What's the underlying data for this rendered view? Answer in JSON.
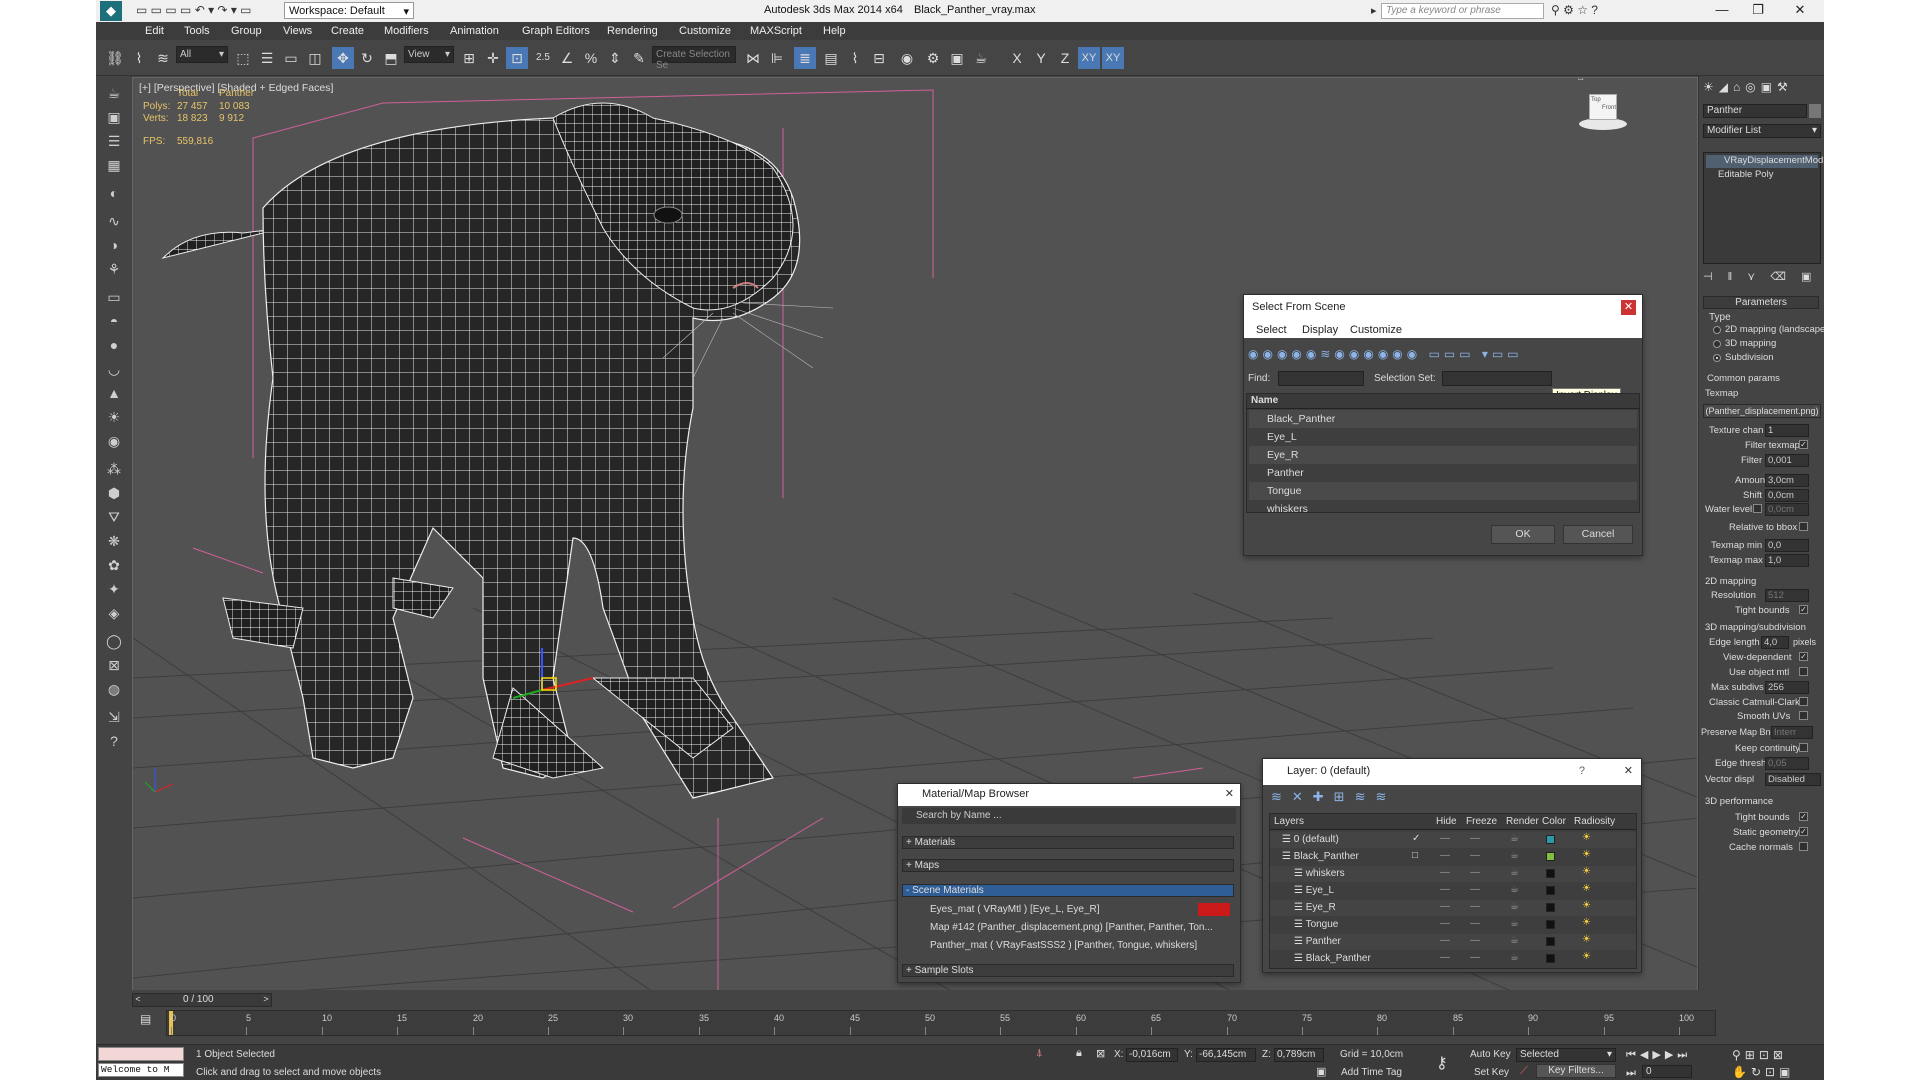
{
  "window": {
    "title": "Autodesk 3ds Max  2014 x64",
    "filename": "Black_Panther_vray.max",
    "workspace": "Workspace: Default",
    "search_placeholder": "Type a keyword or phrase"
  },
  "menu": [
    "Edit",
    "Tools",
    "Group",
    "Views",
    "Create",
    "Modifiers",
    "Animation",
    "Graph Editors",
    "Rendering",
    "Customize",
    "MAXScript",
    "Help"
  ],
  "toolbar": {
    "filter": "All",
    "ref_coord": "View",
    "snap_value": "2.5",
    "selection_set": "Create Selection Se",
    "axes": [
      "X",
      "Y",
      "Z",
      "XY",
      "XY"
    ]
  },
  "viewport": {
    "label": "[+] [Perspective] [Shaded + Edged Faces]",
    "stats": {
      "col_total": "Total",
      "col_obj": "Panther",
      "polys_label": "Polys:",
      "polys_total": "27 457",
      "polys_obj": "10 083",
      "verts_label": "Verts:",
      "verts_total": "18 823",
      "verts_obj": "9 912",
      "fps_label": "FPS:",
      "fps": "559,816"
    },
    "viewcube_labels": [
      "Top",
      "Front"
    ]
  },
  "select_dialog": {
    "title": "Select From Scene",
    "menus": [
      "Select",
      "Display",
      "Customize"
    ],
    "find_label": "Find:",
    "selset_label": "Selection Set:",
    "tooltip": "Invert Display",
    "col_name": "Name",
    "items": [
      "Black_Panther",
      "Eye_L",
      "Eye_R",
      "Panther",
      "Tongue",
      "whiskers"
    ],
    "ok": "OK",
    "cancel": "Cancel"
  },
  "material_browser": {
    "title": "Material/Map Browser",
    "search": "Search by Name ...",
    "groups": [
      "+ Materials",
      "+ Maps",
      "- Scene Materials",
      "+ Sample Slots"
    ],
    "items": [
      "Eyes_mat  ( VRayMtl )  [Eye_L, Eye_R]",
      "Map #142 (Panther_displacement.png)  [Panther, Panther, Ton...",
      "Panther_mat  ( VRayFastSSS2 )  [Panther, Tongue, whiskers]"
    ],
    "swatch_color": "#cc1a1a"
  },
  "layer_dialog": {
    "title": "Layer: 0 (default)",
    "help": "?",
    "cols": [
      "Layers",
      "Hide",
      "Freeze",
      "Render",
      "Color",
      "Radiosity"
    ],
    "rows": [
      {
        "name": "0 (default)",
        "indent": 0,
        "color": "#2a9aa8",
        "check": "✓"
      },
      {
        "name": "Black_Panther",
        "indent": 0,
        "color": "#7fbf3f",
        "check": "□"
      },
      {
        "name": "whiskers",
        "indent": 1,
        "color": "#111111",
        "check": ""
      },
      {
        "name": "Eye_L",
        "indent": 1,
        "color": "#111111",
        "check": ""
      },
      {
        "name": "Eye_R",
        "indent": 1,
        "color": "#111111",
        "check": ""
      },
      {
        "name": "Tongue",
        "indent": 1,
        "color": "#111111",
        "check": ""
      },
      {
        "name": "Panther",
        "indent": 1,
        "color": "#111111",
        "check": ""
      },
      {
        "name": "Black_Panther",
        "indent": 1,
        "color": "#111111",
        "check": ""
      }
    ]
  },
  "command_panel": {
    "object_name": "Panther",
    "modifier_list": "Modifier List",
    "stack": [
      "VRayDisplacementMod",
      "Editable Poly"
    ],
    "rollout_title": "Parameters",
    "type_label": "Type",
    "types": [
      "2D mapping (landscape)",
      "3D mapping",
      "Subdivision"
    ],
    "common_params": "Common params",
    "texmap_label": "Texmap",
    "texmap_value": "(Panther_displacement.png)",
    "texture_chan": {
      "label": "Texture chan",
      "value": "1"
    },
    "filter_texmap": "Filter texmap",
    "filter_blur": {
      "label": "Filter blur",
      "value": "0,001"
    },
    "amount": {
      "label": "Amount",
      "value": "3,0cm"
    },
    "shift": {
      "label": "Shift",
      "value": "0,0cm"
    },
    "water_level": {
      "label": "Water level",
      "value": "0,0cm"
    },
    "relative_bbox": "Relative to bbox",
    "texmap_min": {
      "label": "Texmap min",
      "value": "0,0"
    },
    "texmap_max": {
      "label": "Texmap max",
      "value": "1,0"
    },
    "mapping2d": "2D mapping",
    "resolution": {
      "label": "Resolution",
      "value": "512"
    },
    "tight_bounds": "Tight bounds",
    "mapping3d": "3D mapping/subdivision",
    "edge_length": {
      "label": "Edge length",
      "value": "4,0",
      "unit": "pixels"
    },
    "view_dependent": "View-dependent",
    "use_object_mtl": "Use object mtl",
    "max_subdivs": {
      "label": "Max subdivs",
      "value": "256"
    },
    "classic_cc": "Classic Catmull-Clark",
    "smooth_uvs": "Smooth UVs",
    "preserve_map": {
      "label": "Preserve Map Bnd",
      "value": "Interr"
    },
    "keep_continuity": "Keep continuity",
    "edge_thresh": {
      "label": "Edge thresh",
      "value": "0,05"
    },
    "vector_displ": {
      "label": "Vector displ",
      "value": "Disabled"
    },
    "perf": "3D performance",
    "perf_tight": "Tight bounds",
    "static_geo": "Static geometry",
    "cache_normals": "Cache normals"
  },
  "timeline": {
    "frame": "0 / 100",
    "ticks": [
      "0",
      "5",
      "10",
      "15",
      "20",
      "25",
      "30",
      "35",
      "40",
      "45",
      "50",
      "55",
      "60",
      "65",
      "70",
      "75",
      "80",
      "85",
      "90",
      "95",
      "100"
    ]
  },
  "status": {
    "script_box": "Welcome to M",
    "selected": "1 Object Selected",
    "prompt": "Click and drag to select and move objects",
    "x_label": "X:",
    "x": "-0,016cm",
    "y_label": "Y:",
    "y": "-66,145cm",
    "z_label": "Z:",
    "z": "0,789cm",
    "grid": "Grid = 10,0cm",
    "add_time_tag": "Add Time Tag",
    "auto_key": "Auto Key",
    "set_key": "Set Key",
    "key_mode": "Selected",
    "key_filters": "Key Filters...",
    "frame_field": "0"
  }
}
